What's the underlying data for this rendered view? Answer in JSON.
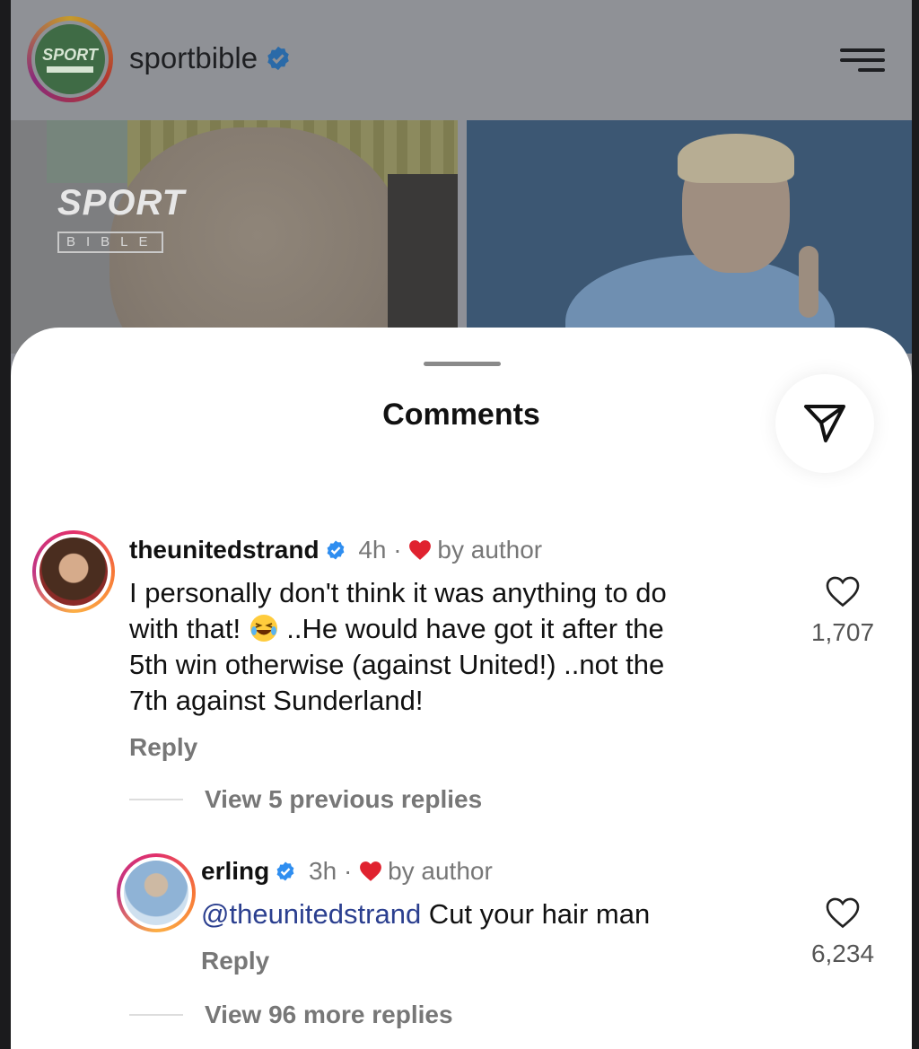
{
  "post": {
    "account": "sportbible",
    "logo_text": "SPORT",
    "image_left_logo": "SPORT",
    "image_left_logo_sub": "BIBLE"
  },
  "sheet": {
    "title": "Comments"
  },
  "comments": [
    {
      "username": "theunitedstrand",
      "time": "4h",
      "separator": "·",
      "by_author": "by author",
      "text_line1": "I personally don't think it was anything to do",
      "text_line2_a": "with that! ",
      "text_line2_b": " ..He would have got it after the",
      "text_line3": "5th win otherwise (against United!) ..not the",
      "text_line4": "7th against Sunderland!",
      "reply_label": "Reply",
      "likes": "1,707",
      "view_replies": "View 5 previous replies"
    },
    {
      "username": "erling",
      "time": "3h",
      "separator": "·",
      "by_author": "by author",
      "mention": "@theunitedstrand",
      "text": " Cut your hair man",
      "reply_label": "Reply",
      "likes": "6,234",
      "view_replies": "View 96 more replies"
    }
  ],
  "icons": {
    "share": "paper-plane-icon",
    "like": "heart-outline-icon",
    "liked_by_author": "heart-filled-icon",
    "verified": "verified-badge-icon",
    "menu": "menu-icon",
    "emoji": "laughing-emoji-icon"
  },
  "colors": {
    "verified": "#2f8ef0",
    "heart": "#e0222f",
    "mention": "#2b3f8f"
  }
}
